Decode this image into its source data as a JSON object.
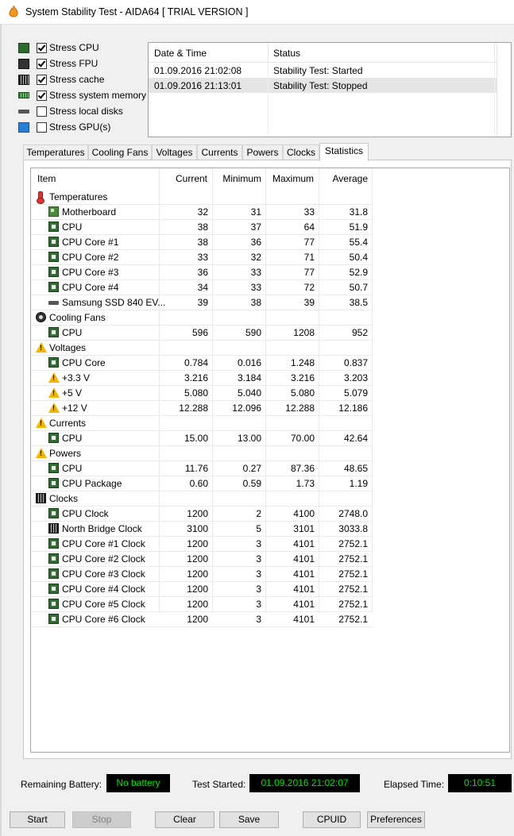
{
  "window": {
    "title": "System Stability Test - AIDA64  [ TRIAL VERSION ]"
  },
  "stress_options": [
    {
      "label": "Stress CPU",
      "checked": true,
      "icon": "cpu-chip-icon"
    },
    {
      "label": "Stress FPU",
      "checked": true,
      "icon": "fpu-icon"
    },
    {
      "label": "Stress cache",
      "checked": true,
      "icon": "cache-icon"
    },
    {
      "label": "Stress system memory",
      "checked": true,
      "icon": "memory-icon"
    },
    {
      "label": "Stress local disks",
      "checked": false,
      "icon": "disk-icon"
    },
    {
      "label": "Stress GPU(s)",
      "checked": false,
      "icon": "monitor-icon"
    }
  ],
  "log": {
    "headers": {
      "datetime": "Date & Time",
      "status": "Status"
    },
    "rows": [
      {
        "datetime": "01.09.2016 21:02:08",
        "status": "Stability Test: Started"
      },
      {
        "datetime": "01.09.2016 21:13:01",
        "status": "Stability Test: Stopped"
      }
    ]
  },
  "tabs": [
    "Temperatures",
    "Cooling Fans",
    "Voltages",
    "Currents",
    "Powers",
    "Clocks",
    "Statistics"
  ],
  "active_tab": "Statistics",
  "statistics": {
    "headers": {
      "item": "Item",
      "current": "Current",
      "minimum": "Minimum",
      "maximum": "Maximum",
      "average": "Average"
    },
    "rows": [
      {
        "type": "group",
        "name": "Temperatures",
        "icon": "thermometer-icon"
      },
      {
        "name": "Motherboard",
        "icon": "motherboard-icon",
        "current": "32",
        "minimum": "31",
        "maximum": "33",
        "average": "31.8"
      },
      {
        "name": "CPU",
        "icon": "cpu-chip-icon",
        "current": "38",
        "minimum": "37",
        "maximum": "64",
        "average": "51.9"
      },
      {
        "name": "CPU Core #1",
        "icon": "cpu-chip-icon",
        "current": "38",
        "minimum": "36",
        "maximum": "77",
        "average": "55.4"
      },
      {
        "name": "CPU Core #2",
        "icon": "cpu-chip-icon",
        "current": "33",
        "minimum": "32",
        "maximum": "71",
        "average": "50.4"
      },
      {
        "name": "CPU Core #3",
        "icon": "cpu-chip-icon",
        "current": "36",
        "minimum": "33",
        "maximum": "77",
        "average": "52.9"
      },
      {
        "name": "CPU Core #4",
        "icon": "cpu-chip-icon",
        "current": "34",
        "minimum": "33",
        "maximum": "72",
        "average": "50.7"
      },
      {
        "name": "Samsung SSD 840 EV...",
        "icon": "ssd-icon",
        "current": "39",
        "minimum": "38",
        "maximum": "39",
        "average": "38.5"
      },
      {
        "type": "group",
        "name": "Cooling Fans",
        "icon": "fan-icon"
      },
      {
        "name": "CPU",
        "icon": "cpu-chip-icon",
        "current": "596",
        "minimum": "590",
        "maximum": "1208",
        "average": "952"
      },
      {
        "type": "group",
        "name": "Voltages",
        "icon": "warning-icon"
      },
      {
        "name": "CPU Core",
        "icon": "cpu-chip-icon",
        "current": "0.784",
        "minimum": "0.016",
        "maximum": "1.248",
        "average": "0.837"
      },
      {
        "name": "+3.3 V",
        "icon": "warning-icon",
        "current": "3.216",
        "minimum": "3.184",
        "maximum": "3.216",
        "average": "3.203"
      },
      {
        "name": "+5 V",
        "icon": "warning-icon",
        "current": "5.080",
        "minimum": "5.040",
        "maximum": "5.080",
        "average": "5.079"
      },
      {
        "name": "+12 V",
        "icon": "warning-icon",
        "current": "12.288",
        "minimum": "12.096",
        "maximum": "12.288",
        "average": "12.186"
      },
      {
        "type": "group",
        "name": "Currents",
        "icon": "warning-icon"
      },
      {
        "name": "CPU",
        "icon": "cpu-chip-icon",
        "current": "15.00",
        "minimum": "13.00",
        "maximum": "70.00",
        "average": "42.64"
      },
      {
        "type": "group",
        "name": "Powers",
        "icon": "warning-icon"
      },
      {
        "name": "CPU",
        "icon": "cpu-chip-icon",
        "current": "11.76",
        "minimum": "0.27",
        "maximum": "87.36",
        "average": "48.65"
      },
      {
        "name": "CPU Package",
        "icon": "cpu-chip-icon",
        "current": "0.60",
        "minimum": "0.59",
        "maximum": "1.73",
        "average": "1.19"
      },
      {
        "type": "group",
        "name": "Clocks",
        "icon": "clock-chip-icon"
      },
      {
        "name": "CPU Clock",
        "icon": "cpu-chip-icon",
        "current": "1200",
        "minimum": "2",
        "maximum": "4100",
        "average": "2748.0"
      },
      {
        "name": "North Bridge Clock",
        "icon": "clock-chip-icon",
        "current": "3100",
        "minimum": "5",
        "maximum": "3101",
        "average": "3033.8"
      },
      {
        "name": "CPU Core #1 Clock",
        "icon": "cpu-chip-icon",
        "current": "1200",
        "minimum": "3",
        "maximum": "4101",
        "average": "2752.1"
      },
      {
        "name": "CPU Core #2 Clock",
        "icon": "cpu-chip-icon",
        "current": "1200",
        "minimum": "3",
        "maximum": "4101",
        "average": "2752.1"
      },
      {
        "name": "CPU Core #3 Clock",
        "icon": "cpu-chip-icon",
        "current": "1200",
        "minimum": "3",
        "maximum": "4101",
        "average": "2752.1"
      },
      {
        "name": "CPU Core #4 Clock",
        "icon": "cpu-chip-icon",
        "current": "1200",
        "minimum": "3",
        "maximum": "4101",
        "average": "2752.1"
      },
      {
        "name": "CPU Core #5 Clock",
        "icon": "cpu-chip-icon",
        "current": "1200",
        "minimum": "3",
        "maximum": "4101",
        "average": "2752.1"
      },
      {
        "name": "CPU Core #6 Clock",
        "icon": "cpu-chip-icon",
        "current": "1200",
        "minimum": "3",
        "maximum": "4101",
        "average": "2752.1"
      }
    ]
  },
  "status_bar": {
    "battery_label": "Remaining Battery:",
    "battery_value": "No battery",
    "started_label": "Test Started:",
    "started_value": "01.09.2016 21:02:07",
    "elapsed_label": "Elapsed Time:",
    "elapsed_value": "0:10:51"
  },
  "buttons": {
    "start": "Start",
    "stop": "Stop",
    "clear": "Clear",
    "save": "Save",
    "cpuid": "CPUID",
    "preferences": "Preferences"
  },
  "colors": {
    "status_bg": "#000000",
    "status_text": "#00e000",
    "warning": "#f2b600"
  }
}
